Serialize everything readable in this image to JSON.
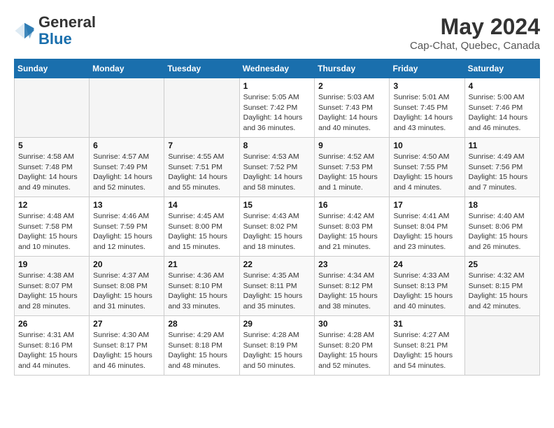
{
  "header": {
    "logo_line1": "General",
    "logo_line2": "Blue",
    "month_year": "May 2024",
    "location": "Cap-Chat, Quebec, Canada"
  },
  "weekdays": [
    "Sunday",
    "Monday",
    "Tuesday",
    "Wednesday",
    "Thursday",
    "Friday",
    "Saturday"
  ],
  "weeks": [
    [
      {
        "day": "",
        "info": ""
      },
      {
        "day": "",
        "info": ""
      },
      {
        "day": "",
        "info": ""
      },
      {
        "day": "1",
        "info": "Sunrise: 5:05 AM\nSunset: 7:42 PM\nDaylight: 14 hours\nand 36 minutes."
      },
      {
        "day": "2",
        "info": "Sunrise: 5:03 AM\nSunset: 7:43 PM\nDaylight: 14 hours\nand 40 minutes."
      },
      {
        "day": "3",
        "info": "Sunrise: 5:01 AM\nSunset: 7:45 PM\nDaylight: 14 hours\nand 43 minutes."
      },
      {
        "day": "4",
        "info": "Sunrise: 5:00 AM\nSunset: 7:46 PM\nDaylight: 14 hours\nand 46 minutes."
      }
    ],
    [
      {
        "day": "5",
        "info": "Sunrise: 4:58 AM\nSunset: 7:48 PM\nDaylight: 14 hours\nand 49 minutes."
      },
      {
        "day": "6",
        "info": "Sunrise: 4:57 AM\nSunset: 7:49 PM\nDaylight: 14 hours\nand 52 minutes."
      },
      {
        "day": "7",
        "info": "Sunrise: 4:55 AM\nSunset: 7:51 PM\nDaylight: 14 hours\nand 55 minutes."
      },
      {
        "day": "8",
        "info": "Sunrise: 4:53 AM\nSunset: 7:52 PM\nDaylight: 14 hours\nand 58 minutes."
      },
      {
        "day": "9",
        "info": "Sunrise: 4:52 AM\nSunset: 7:53 PM\nDaylight: 15 hours\nand 1 minute."
      },
      {
        "day": "10",
        "info": "Sunrise: 4:50 AM\nSunset: 7:55 PM\nDaylight: 15 hours\nand 4 minutes."
      },
      {
        "day": "11",
        "info": "Sunrise: 4:49 AM\nSunset: 7:56 PM\nDaylight: 15 hours\nand 7 minutes."
      }
    ],
    [
      {
        "day": "12",
        "info": "Sunrise: 4:48 AM\nSunset: 7:58 PM\nDaylight: 15 hours\nand 10 minutes."
      },
      {
        "day": "13",
        "info": "Sunrise: 4:46 AM\nSunset: 7:59 PM\nDaylight: 15 hours\nand 12 minutes."
      },
      {
        "day": "14",
        "info": "Sunrise: 4:45 AM\nSunset: 8:00 PM\nDaylight: 15 hours\nand 15 minutes."
      },
      {
        "day": "15",
        "info": "Sunrise: 4:43 AM\nSunset: 8:02 PM\nDaylight: 15 hours\nand 18 minutes."
      },
      {
        "day": "16",
        "info": "Sunrise: 4:42 AM\nSunset: 8:03 PM\nDaylight: 15 hours\nand 21 minutes."
      },
      {
        "day": "17",
        "info": "Sunrise: 4:41 AM\nSunset: 8:04 PM\nDaylight: 15 hours\nand 23 minutes."
      },
      {
        "day": "18",
        "info": "Sunrise: 4:40 AM\nSunset: 8:06 PM\nDaylight: 15 hours\nand 26 minutes."
      }
    ],
    [
      {
        "day": "19",
        "info": "Sunrise: 4:38 AM\nSunset: 8:07 PM\nDaylight: 15 hours\nand 28 minutes."
      },
      {
        "day": "20",
        "info": "Sunrise: 4:37 AM\nSunset: 8:08 PM\nDaylight: 15 hours\nand 31 minutes."
      },
      {
        "day": "21",
        "info": "Sunrise: 4:36 AM\nSunset: 8:10 PM\nDaylight: 15 hours\nand 33 minutes."
      },
      {
        "day": "22",
        "info": "Sunrise: 4:35 AM\nSunset: 8:11 PM\nDaylight: 15 hours\nand 35 minutes."
      },
      {
        "day": "23",
        "info": "Sunrise: 4:34 AM\nSunset: 8:12 PM\nDaylight: 15 hours\nand 38 minutes."
      },
      {
        "day": "24",
        "info": "Sunrise: 4:33 AM\nSunset: 8:13 PM\nDaylight: 15 hours\nand 40 minutes."
      },
      {
        "day": "25",
        "info": "Sunrise: 4:32 AM\nSunset: 8:15 PM\nDaylight: 15 hours\nand 42 minutes."
      }
    ],
    [
      {
        "day": "26",
        "info": "Sunrise: 4:31 AM\nSunset: 8:16 PM\nDaylight: 15 hours\nand 44 minutes."
      },
      {
        "day": "27",
        "info": "Sunrise: 4:30 AM\nSunset: 8:17 PM\nDaylight: 15 hours\nand 46 minutes."
      },
      {
        "day": "28",
        "info": "Sunrise: 4:29 AM\nSunset: 8:18 PM\nDaylight: 15 hours\nand 48 minutes."
      },
      {
        "day": "29",
        "info": "Sunrise: 4:28 AM\nSunset: 8:19 PM\nDaylight: 15 hours\nand 50 minutes."
      },
      {
        "day": "30",
        "info": "Sunrise: 4:28 AM\nSunset: 8:20 PM\nDaylight: 15 hours\nand 52 minutes."
      },
      {
        "day": "31",
        "info": "Sunrise: 4:27 AM\nSunset: 8:21 PM\nDaylight: 15 hours\nand 54 minutes."
      },
      {
        "day": "",
        "info": ""
      }
    ]
  ]
}
